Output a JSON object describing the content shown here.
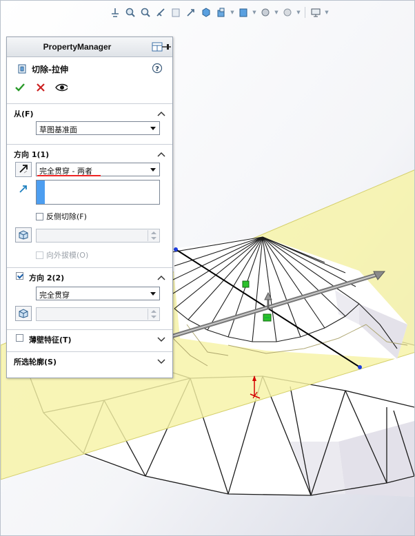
{
  "property_manager": {
    "title": "PropertyManager",
    "feature_name": "切除-拉伸",
    "from": {
      "label": "从(F)",
      "value": "草图基准面"
    },
    "direction1": {
      "label": "方向 1(1)",
      "end_condition": "完全贯穿 - 两者",
      "flip_side_label": "反侧切除(F)",
      "draft_outward_label": "向外拔模(O)"
    },
    "direction2": {
      "label": "方向 2(2)",
      "end_condition": "完全贯穿"
    },
    "thin_feature_label": "薄壁特征(T)",
    "selected_contours_label": "所选轮廓(S)"
  },
  "icons": {
    "ok": "check-icon",
    "cancel": "close-icon",
    "preview": "eye-icon",
    "help": "help-icon",
    "pin": "pin-icon"
  },
  "colors": {
    "plane_fill": "#f6f3a6",
    "accent_blue": "#4d9ef0",
    "ok_green": "#2a9a2a",
    "cancel_red": "#cc2222"
  }
}
